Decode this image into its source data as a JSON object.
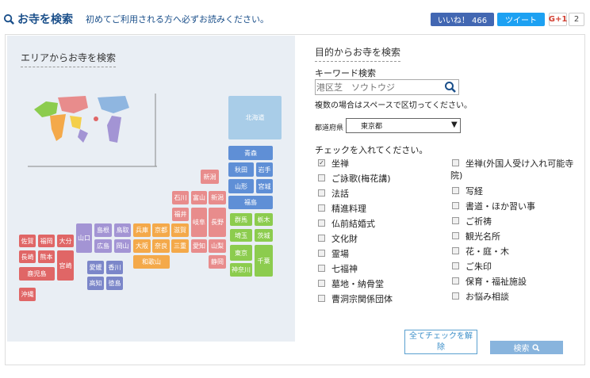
{
  "header": {
    "title": "お寺を検索",
    "first_time_link": "初めてご利用される方へ必ずお読みください。",
    "like_label": "いいね！ 466",
    "tweet_label": "ツイート",
    "gplus_label": "G+1",
    "gplus_count": "2"
  },
  "area_search": {
    "title": "エリアからお寺を検索",
    "hokkaido": "北海道",
    "tohoku": [
      "青森",
      "秋田",
      "岩手",
      "山形",
      "宮城",
      "福島"
    ],
    "kanto": [
      "群馬",
      "栃木",
      "埼玉",
      "茨城",
      "東京",
      "千葉",
      "神奈川"
    ],
    "chubu": [
      "新潟",
      "富山",
      "石川",
      "福井",
      "長野",
      "岐阜",
      "山梨",
      "愛知",
      "静岡"
    ],
    "kinki": [
      "兵庫",
      "京都",
      "滋賀",
      "大阪",
      "奈良",
      "三重",
      "和歌山"
    ],
    "chugoku": [
      "鳥取",
      "島根",
      "岡山",
      "広島",
      "山口"
    ],
    "shikoku": [
      "愛媛",
      "香川",
      "高知",
      "徳島"
    ],
    "kyushu": [
      "佐賀",
      "福岡",
      "大分",
      "長崎",
      "熊本",
      "宮崎",
      "鹿児島",
      "沖縄"
    ]
  },
  "purpose_search": {
    "title": "目的からお寺を検索",
    "keyword_label": "キーワード検索",
    "keyword_placeholder": "港区芝　ソウトウジ",
    "keyword_note": "複数の場合はスペースで区切ってください。",
    "prefecture_label": "都道府県",
    "prefecture_selected": "東京都",
    "check_label": "チェックを入れてください。",
    "checkboxes_left": [
      {
        "label": "坐禅",
        "checked": true
      },
      {
        "label": "ご詠歌(梅花講)",
        "checked": false
      },
      {
        "label": "法話",
        "checked": false
      },
      {
        "label": "精進料理",
        "checked": false
      },
      {
        "label": "仏前結婚式",
        "checked": false
      },
      {
        "label": "文化財",
        "checked": false
      },
      {
        "label": "霊場",
        "checked": false
      },
      {
        "label": "七福神",
        "checked": false
      },
      {
        "label": "墓地・納骨堂",
        "checked": false
      },
      {
        "label": "曹洞宗関係団体",
        "checked": false
      }
    ],
    "checkboxes_right_first_line": "坐禅(外国人受け入れ可能寺",
    "checkboxes_right_first_cont": "院)",
    "checkboxes_right": [
      {
        "label": "写経",
        "checked": false
      },
      {
        "label": "書道・ほか習い事",
        "checked": false
      },
      {
        "label": "ご祈祷",
        "checked": false
      },
      {
        "label": "観光名所",
        "checked": false
      },
      {
        "label": "花・庭・木",
        "checked": false
      },
      {
        "label": "ご朱印",
        "checked": false
      },
      {
        "label": "保育・福祉施設",
        "checked": false
      },
      {
        "label": "お悩み相談",
        "checked": false
      }
    ],
    "uncheck_all_label": "全てチェックを解除",
    "search_label": "検索"
  },
  "colors": {
    "link": "#1a4f8a",
    "button": "#88b4dd"
  }
}
